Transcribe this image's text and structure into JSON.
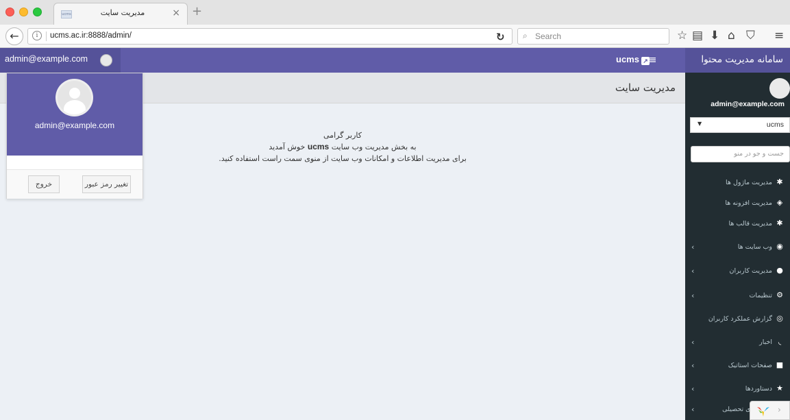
{
  "browser": {
    "tab_title": "مدیریت سایت",
    "tab_favicon_text": "ucms",
    "tab_close": "×",
    "new_tab": "+",
    "url": "ucms.ac.ir:8888/admin/",
    "search_placeholder": "Search"
  },
  "header": {
    "user_email": "admin@example.com",
    "logo_text": "ucms",
    "brand_title": "سامانه مدیریت محتوا"
  },
  "content": {
    "page_title": "مدیریت سایت",
    "welcome_line1": "کاربر گرامی",
    "welcome_line2_pre": "به بخش مدیریت وب سایت",
    "welcome_brand": "ucms",
    "welcome_line2_post": "خوش آمدید",
    "welcome_line3": "برای مدیریت اطلاعات و امکانات وب سایت از منوی سمت راست استفاده کنید."
  },
  "user_menu": {
    "email": "admin@example.com",
    "change_password_label": "تغییر رمز عبور",
    "logout_label": "خروج"
  },
  "sidebar": {
    "user_email": "admin@example.com",
    "site_select_value": "ucms",
    "search_placeholder": "جست و جو در منو",
    "items": [
      {
        "label": "مدیریت ماژول ها",
        "icon": "gear-icon",
        "has_children": false
      },
      {
        "label": "مدیریت افزونه ها",
        "icon": "cube-icon",
        "has_children": false
      },
      {
        "label": "مدیریت قالب ها",
        "icon": "gear-icon",
        "has_children": false
      },
      {
        "label": "وب سایت ها",
        "icon": "globe-icon",
        "has_children": true
      },
      {
        "label": "مدیریت کاربران",
        "icon": "user-icon",
        "has_children": true
      },
      {
        "label": "تنظیمات",
        "icon": "gears-icon",
        "has_children": true
      },
      {
        "label": "گزارش عملکرد کاربران",
        "icon": "eye-icon",
        "has_children": false
      },
      {
        "label": "اخبار",
        "icon": "rss-icon",
        "has_children": true
      },
      {
        "label": "صفحات استاتیک",
        "icon": "file-icon",
        "has_children": true
      },
      {
        "label": "دستاوردها",
        "icon": "star-icon",
        "has_children": true
      },
      {
        "label": "رشته های تحصیلی",
        "icon": "graduation-icon",
        "has_children": true
      }
    ]
  },
  "colors": {
    "header_purple": "#605ca8",
    "header_purple_dark": "#555299",
    "sidebar_bg": "#222d32",
    "content_bg": "#ecf0f5"
  }
}
